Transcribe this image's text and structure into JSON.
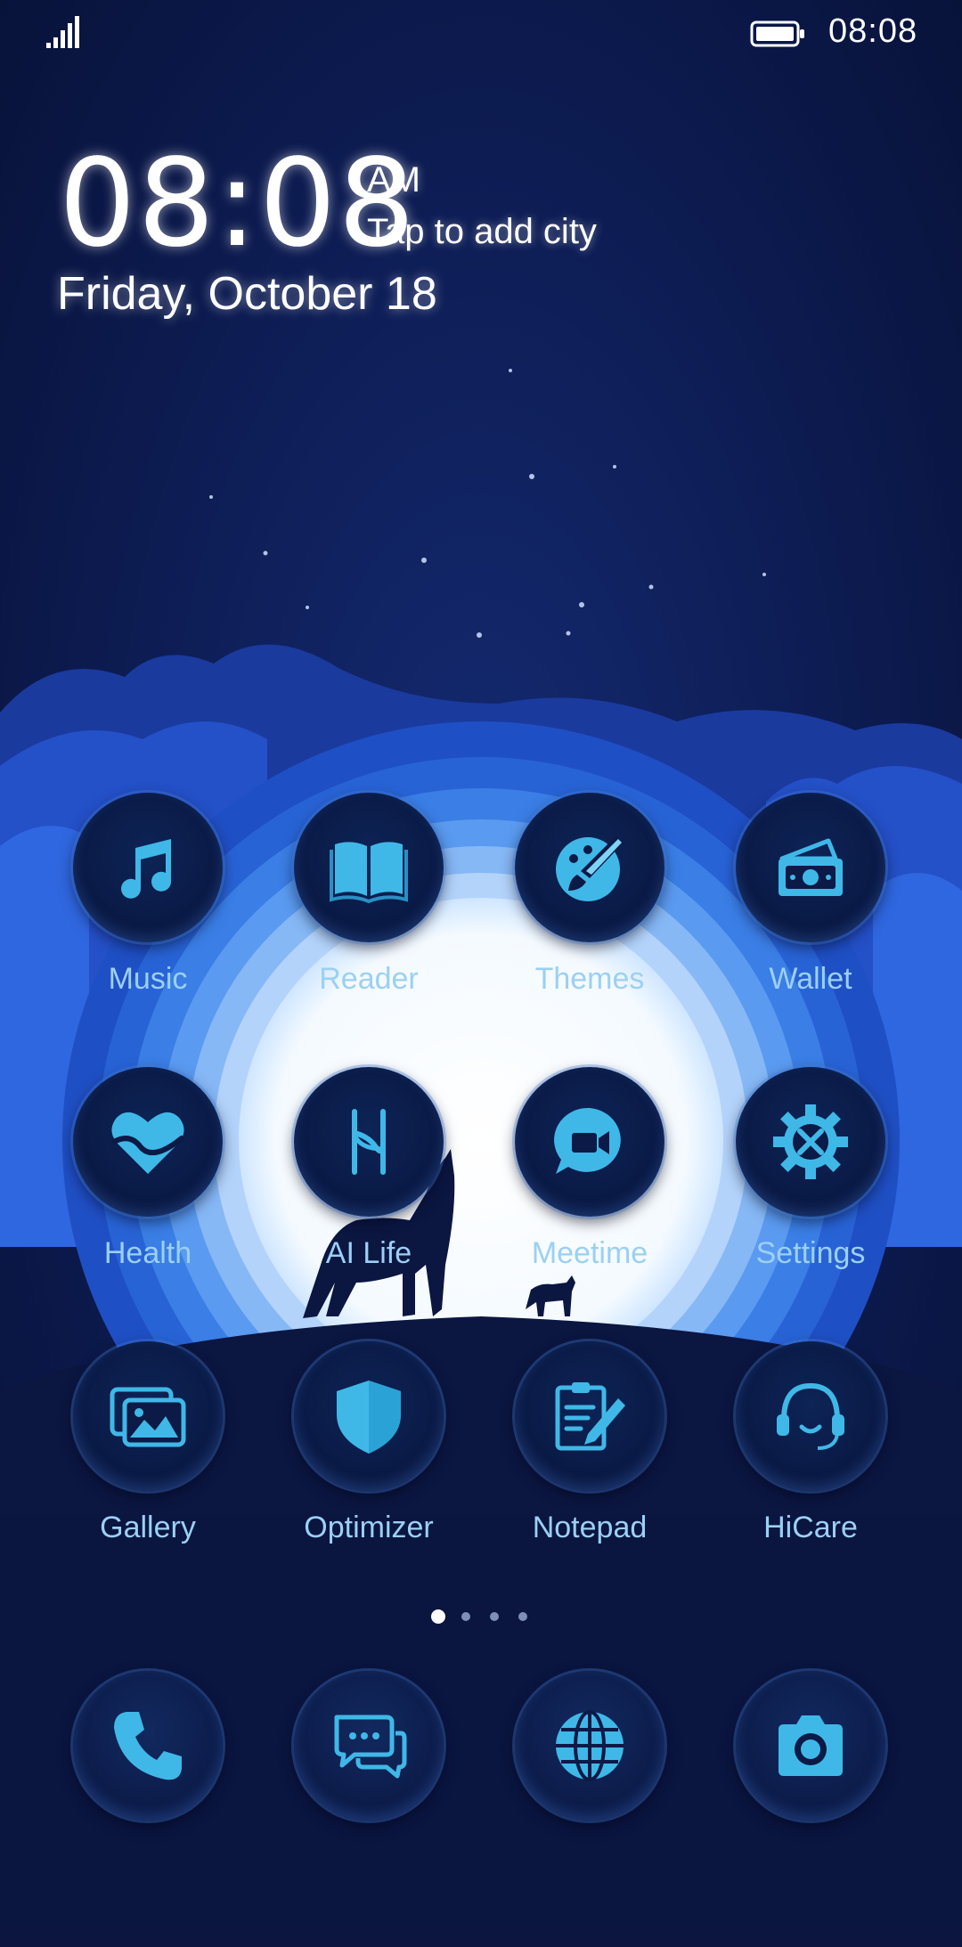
{
  "status_bar": {
    "time": "08:08",
    "signal_icon": "signal-bars-icon",
    "battery_icon": "battery-icon"
  },
  "clock_widget": {
    "time": "08:08",
    "ampm": "AM",
    "city_prompt": "Tap to add city",
    "date": "Friday, October 18"
  },
  "apps": [
    {
      "label": "Music",
      "icon": "music-note-icon"
    },
    {
      "label": "Reader",
      "icon": "book-icon"
    },
    {
      "label": "Themes",
      "icon": "paintbrush-icon"
    },
    {
      "label": "Wallet",
      "icon": "wallet-icon"
    },
    {
      "label": "Health",
      "icon": "heart-icon"
    },
    {
      "label": "AI Life",
      "icon": "ai-life-icon"
    },
    {
      "label": "Meetime",
      "icon": "video-chat-icon"
    },
    {
      "label": "Settings",
      "icon": "gear-icon"
    },
    {
      "label": "Gallery",
      "icon": "gallery-icon"
    },
    {
      "label": "Optimizer",
      "icon": "shield-icon"
    },
    {
      "label": "Notepad",
      "icon": "notepad-icon"
    },
    {
      "label": "HiCare",
      "icon": "headset-icon"
    }
  ],
  "dock": [
    {
      "icon": "phone-icon"
    },
    {
      "icon": "messages-icon"
    },
    {
      "icon": "browser-globe-icon"
    },
    {
      "icon": "camera-icon"
    }
  ],
  "page_indicator": {
    "pages": 4,
    "current": 1
  },
  "colors": {
    "background": "#0b1540",
    "accent": "#3fb8e8",
    "label": "#9bd0f4",
    "moon": "#ffffff"
  }
}
